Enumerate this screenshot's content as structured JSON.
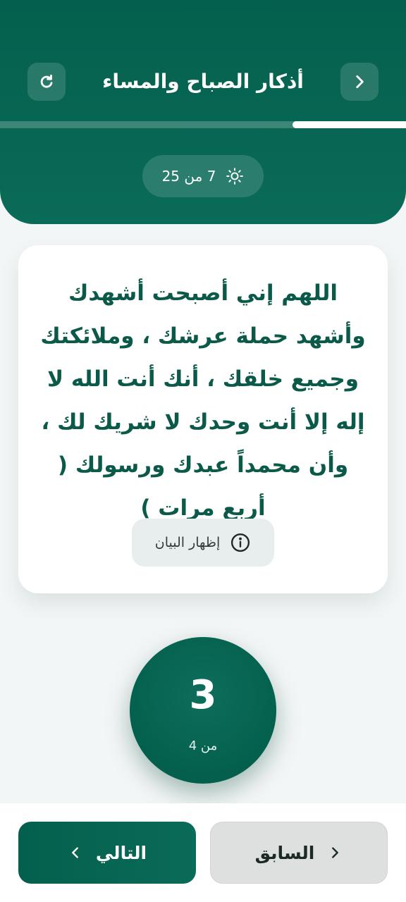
{
  "header": {
    "title": "أذكار الصباح والمساء",
    "progress_fraction": 0.28,
    "count_text": "7 من 25",
    "back_icon": "chevron-right-icon",
    "refresh_icon": "refresh-icon",
    "sun_icon": "sun-icon"
  },
  "card": {
    "dhikr_text": "اللهم إني أصبحت  أشهدك وأشهد حملة عرشك ، وملائكتك وجميع خلقك ، أنك أنت الله لا إله إلا أنت وحدك لا شريك لك ، وأن محمداً عبدك ورسولك ( أربع مرات )",
    "show_explanation_label": "إظهار البيان",
    "info_icon": "info-icon"
  },
  "counter": {
    "current": "3",
    "total_text": "من 4"
  },
  "footer": {
    "prev_label": "السابق",
    "next_label": "التالي"
  },
  "colors": {
    "primary": "#04604d",
    "primary_light": "#0a6b58",
    "text_green": "#0b5a49",
    "background": "#f3f6f6"
  }
}
